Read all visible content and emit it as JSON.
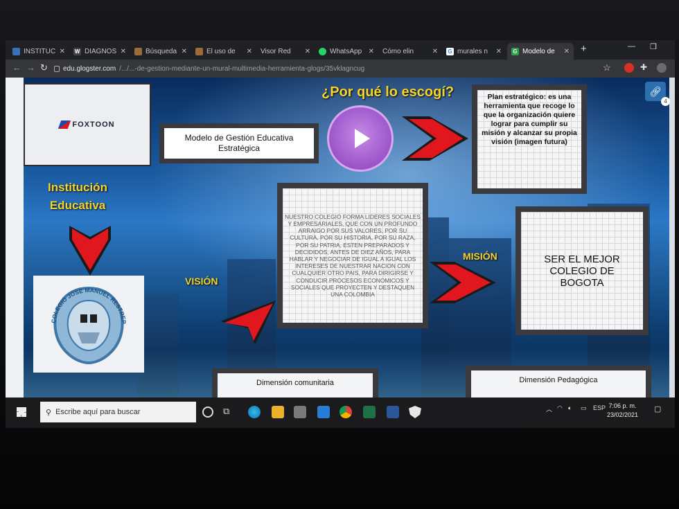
{
  "browser": {
    "tabs": [
      {
        "label": "INSTITUC",
        "favicon": "blue-square-icon",
        "color": "#3b6fb6"
      },
      {
        "label": "DIAGNOS",
        "favicon": "wix-icon",
        "color": "#444444"
      },
      {
        "label": "Búsqueda",
        "favicon": "doc-icon",
        "color": "#9c6b3a"
      },
      {
        "label": "El uso de",
        "favicon": "doc-icon",
        "color": "#9c6b3a"
      },
      {
        "label": "Visor Red",
        "favicon": "",
        "color": "#202124"
      },
      {
        "label": "WhatsApp",
        "favicon": "whatsapp-icon",
        "color": "#25d366"
      },
      {
        "label": "Cómo elin",
        "favicon": "",
        "color": "#202124"
      },
      {
        "label": "murales n",
        "favicon": "google-icon",
        "color": "#ffffff"
      },
      {
        "label": "Modelo de",
        "favicon": "glogster-icon",
        "color": "#2e9e48",
        "active": true
      }
    ],
    "url_domain": "edu.glogster.com",
    "url_path": "/.../...-de-gestion-mediante-un-mural-multimedia-herramienta-glogs/35vklagncug"
  },
  "glog": {
    "logo_text": "FOXTOON",
    "modelo_title": "Modelo de Gestión Educativa Estratégica",
    "question_heading": "¿Por qué lo escogí?",
    "plan_text": "Plan estratégico: es una herramienta que recoge lo que la organización quiere lograr para cumplir su misión y alcanzar su propia visión (imagen futura)",
    "institucion_label": "Institución Educativa",
    "school_seal": "COLEGIO JOSE MANUEL RESTREPO",
    "vision_label": "VISIÓN",
    "vision_text": "NUESTRO COLEGIO FORMA LIDERES SOCIALES Y EMPRESARIALES, QUE CON UN PROFUNDO ARRAIGO POR SUS VALORES, POR SU CULTURA, POR SU HISTORIA, POR SU RAZA, POR SU PATRIA, ESTEN PREPARADOS Y DECIDIDOS, ANTES DE DIEZ AÑOS, PARA HABLAR Y NEGOCIAR DE IGUAL A IGUAL LOS INTERESES DE NUESTRAR NACION CON CUALQUIER OTRO PAIS, PARA DIRIGIRSE Y CONDUCIR PROCESOS ECONOMICOS Y SOCIALES QUE PROYECTEN Y DESTAQUEN UNA COLOMBIA",
    "mision_label": "MISIÓN",
    "mision_text": "SER EL MEJOR COLEGIO DE BOGOTA",
    "dim_comunitaria": "Dimensión comunitaria",
    "dim_pedagogica": "Dimensión Pedagógica",
    "link_count": "4"
  },
  "taskbar": {
    "search_placeholder": "Escribe aquí para buscar",
    "language": "ESP",
    "time": "7:06 p. m.",
    "date": "23/02/2021"
  },
  "colors": {
    "accent_yellow": "#f6d42a",
    "arrow_red": "#e0171e",
    "play_purple": "#a45fd0"
  }
}
